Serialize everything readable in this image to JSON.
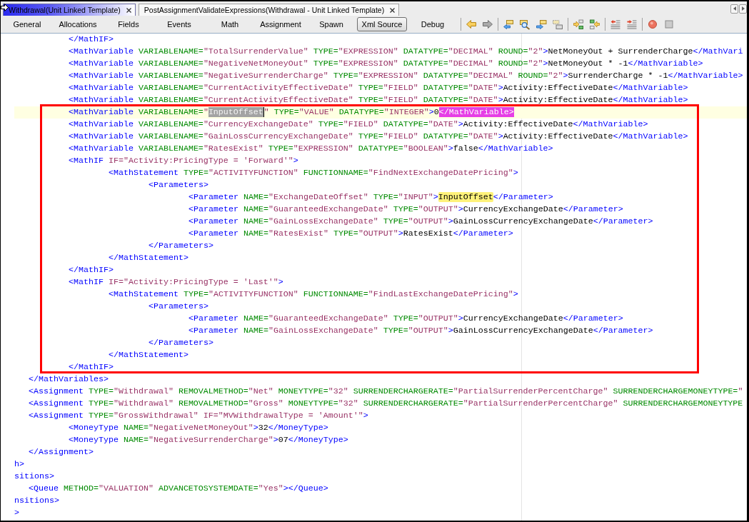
{
  "document_tabs": [
    {
      "label": "Withdrawal(Unit Linked Template)",
      "selected": true
    },
    {
      "label": "PostAssignmentValidateExpressions(Withdrawal - Unit Linked Template)",
      "selected": false
    }
  ],
  "view_tabs": [
    {
      "label": "General",
      "selected": false
    },
    {
      "label": "Allocations",
      "selected": false
    },
    {
      "label": "Fields",
      "selected": false
    },
    {
      "label": "Events",
      "selected": false
    },
    {
      "label": "Math",
      "selected": false
    },
    {
      "label": "Assignment",
      "selected": false
    },
    {
      "label": "Spawn",
      "selected": false
    },
    {
      "label": "Xml Source",
      "selected": true
    },
    {
      "label": "Debug",
      "selected": false
    }
  ],
  "toolbar": {
    "groups": [
      [
        {
          "kind": "back",
          "disabled": false
        },
        {
          "kind": "forward",
          "disabled": true
        }
      ],
      [
        {
          "kind": "cardprev",
          "disabled": false
        },
        {
          "kind": "cardsearch",
          "disabled": false
        },
        {
          "kind": "cardnext",
          "disabled": false
        },
        {
          "kind": "cardstack",
          "disabled": false
        }
      ],
      [
        {
          "kind": "arrowin",
          "disabled": false
        },
        {
          "kind": "arrowout",
          "disabled": false
        }
      ],
      [
        {
          "kind": "outdent",
          "disabled": false
        },
        {
          "kind": "indent",
          "disabled": false
        }
      ],
      [
        {
          "kind": "record",
          "disabled": false
        },
        {
          "kind": "stop",
          "disabled": false
        }
      ]
    ]
  },
  "editor": {
    "lines": [
      {
        "children": [
          {
            "children": [
              {
                "current": false,
                "segments": [
                  {
                    "kind": "tag",
                    "text": "</MathIF>"
                  }
                ]
              },
              {
                "current": false,
                "segments": [
                  {
                    "kind": "tag",
                    "text": "<MathVariable"
                  },
                  {
                    "kind": "attr",
                    "text": " VARIABLENAME="
                  },
                  {
                    "kind": "value",
                    "text": "\"TotalSurrenderValue\""
                  },
                  {
                    "kind": "attr",
                    "text": " TYPE="
                  },
                  {
                    "kind": "value",
                    "text": "\"EXPRESSION\""
                  },
                  {
                    "kind": "attr",
                    "text": " DATATYPE="
                  },
                  {
                    "kind": "value",
                    "text": "\"DECIMAL\""
                  },
                  {
                    "kind": "attr",
                    "text": " ROUND="
                  },
                  {
                    "kind": "value",
                    "text": "\"2\""
                  },
                  {
                    "kind": "tag",
                    "text": ">"
                  },
                  {
                    "kind": "text",
                    "text": "NetMoneyOut + SurrenderCharge"
                  },
                  {
                    "kind": "tag",
                    "text": "</MathVari"
                  }
                ]
              },
              {
                "current": false,
                "segments": [
                  {
                    "kind": "tag",
                    "text": "<MathVariable"
                  },
                  {
                    "kind": "attr",
                    "text": " VARIABLENAME="
                  },
                  {
                    "kind": "value",
                    "text": "\"NegativeNetMoneyOut\""
                  },
                  {
                    "kind": "attr",
                    "text": " TYPE="
                  },
                  {
                    "kind": "value",
                    "text": "\"EXPRESSION\""
                  },
                  {
                    "kind": "attr",
                    "text": " DATATYPE="
                  },
                  {
                    "kind": "value",
                    "text": "\"DECIMAL\""
                  },
                  {
                    "kind": "attr",
                    "text": " ROUND="
                  },
                  {
                    "kind": "value",
                    "text": "\"2\""
                  },
                  {
                    "kind": "tag",
                    "text": ">"
                  },
                  {
                    "kind": "text",
                    "text": "NetMoneyOut * -1"
                  },
                  {
                    "kind": "tag",
                    "text": "</MathVariable>"
                  }
                ]
              },
              {
                "current": false,
                "segments": [
                  {
                    "kind": "tag",
                    "text": "<MathVariable"
                  },
                  {
                    "kind": "attr",
                    "text": " VARIABLENAME="
                  },
                  {
                    "kind": "value",
                    "text": "\"NegativeSurrenderCharge\""
                  },
                  {
                    "kind": "attr",
                    "text": " TYPE="
                  },
                  {
                    "kind": "value",
                    "text": "\"EXPRESSION\""
                  },
                  {
                    "kind": "attr",
                    "text": " DATATYPE="
                  },
                  {
                    "kind": "value",
                    "text": "\"DECIMAL\""
                  },
                  {
                    "kind": "attr",
                    "text": " ROUND="
                  },
                  {
                    "kind": "value",
                    "text": "\"2\""
                  },
                  {
                    "kind": "tag",
                    "text": ">"
                  },
                  {
                    "kind": "text",
                    "text": "SurrenderCharge * -1"
                  },
                  {
                    "kind": "tag",
                    "text": "</MathVariable>"
                  }
                ]
              },
              {
                "current": false,
                "segments": [
                  {
                    "kind": "tag",
                    "text": "<MathVariable"
                  },
                  {
                    "kind": "attr",
                    "text": " VARIABLENAME="
                  },
                  {
                    "kind": "value",
                    "text": "\"CurrentActivityEffectiveDate\""
                  },
                  {
                    "kind": "attr",
                    "text": " TYPE="
                  },
                  {
                    "kind": "value",
                    "text": "\"FIELD\""
                  },
                  {
                    "kind": "attr",
                    "text": " DATATYPE="
                  },
                  {
                    "kind": "value",
                    "text": "\"DATE\""
                  },
                  {
                    "kind": "tag",
                    "text": ">"
                  },
                  {
                    "kind": "text",
                    "text": "Activity:EffectiveDate"
                  },
                  {
                    "kind": "tag",
                    "text": "</MathVariable>"
                  }
                ]
              },
              {
                "current": false,
                "segments": [
                  {
                    "kind": "tag",
                    "text": "<MathVariable"
                  },
                  {
                    "kind": "attr",
                    "text": " VARIABLENAME="
                  },
                  {
                    "kind": "value",
                    "text": "\"CurrentActivityEffectiveDate\""
                  },
                  {
                    "kind": "attr",
                    "text": " TYPE="
                  },
                  {
                    "kind": "value",
                    "text": "\"FIELD\""
                  },
                  {
                    "kind": "attr",
                    "text": " DATATYPE="
                  },
                  {
                    "kind": "value",
                    "text": "\"DATE\""
                  },
                  {
                    "kind": "tag",
                    "text": ">"
                  },
                  {
                    "kind": "text",
                    "text": "Activity:EffectiveDate"
                  },
                  {
                    "kind": "tag",
                    "text": "</MathVariable>"
                  }
                ]
              },
              {
                "current": true,
                "segments": [
                  {
                    "kind": "tag",
                    "text": "<MathVariable"
                  },
                  {
                    "kind": "attr",
                    "text": " VARIABLENAME="
                  },
                  {
                    "kind": "value",
                    "text": "\""
                  },
                  {
                    "kind": "value",
                    "text": "InputOffset",
                    "selected": true,
                    "cursor": true
                  },
                  {
                    "kind": "value",
                    "text": "\""
                  },
                  {
                    "kind": "attr",
                    "text": " TYPE="
                  },
                  {
                    "kind": "value",
                    "text": "\"VALUE\""
                  },
                  {
                    "kind": "attr",
                    "text": " DATATYPE="
                  },
                  {
                    "kind": "value",
                    "text": "\"INTEGER\""
                  },
                  {
                    "kind": "tag",
                    "text": ">"
                  },
                  {
                    "kind": "text",
                    "text": "0"
                  },
                  {
                    "kind": "tag",
                    "text": "</MathVariable>",
                    "matched": true
                  }
                ]
              },
              {
                "current": false,
                "segments": [
                  {
                    "kind": "tag",
                    "text": "<MathVariable"
                  },
                  {
                    "kind": "attr",
                    "text": " VARIABLENAME="
                  },
                  {
                    "kind": "value",
                    "text": "\"CurrencyExchangeDate\""
                  },
                  {
                    "kind": "attr",
                    "text": " TYPE="
                  },
                  {
                    "kind": "value",
                    "text": "\"FIELD\""
                  },
                  {
                    "kind": "attr",
                    "text": " DATATYPE="
                  },
                  {
                    "kind": "value",
                    "text": "\"DATE\""
                  },
                  {
                    "kind": "tag",
                    "text": ">"
                  },
                  {
                    "kind": "text",
                    "text": "Activity:EffectiveDate"
                  },
                  {
                    "kind": "tag",
                    "text": "</MathVariable>"
                  }
                ]
              },
              {
                "current": false,
                "segments": [
                  {
                    "kind": "tag",
                    "text": "<MathVariable"
                  },
                  {
                    "kind": "attr",
                    "text": " VARIABLENAME="
                  },
                  {
                    "kind": "value",
                    "text": "\"GainLossCurrencyExchangeDate\""
                  },
                  {
                    "kind": "attr",
                    "text": " TYPE="
                  },
                  {
                    "kind": "value",
                    "text": "\"FIELD\""
                  },
                  {
                    "kind": "attr",
                    "text": " DATATYPE="
                  },
                  {
                    "kind": "value",
                    "text": "\"DATE\""
                  },
                  {
                    "kind": "tag",
                    "text": ">"
                  },
                  {
                    "kind": "text",
                    "text": "Activity:EffectiveDate"
                  },
                  {
                    "kind": "tag",
                    "text": "</MathVariable>"
                  }
                ]
              },
              {
                "current": false,
                "segments": [
                  {
                    "kind": "tag",
                    "text": "<MathVariable"
                  },
                  {
                    "kind": "attr",
                    "text": " VARIABLENAME="
                  },
                  {
                    "kind": "value",
                    "text": "\"RatesExist\""
                  },
                  {
                    "kind": "attr",
                    "text": " TYPE="
                  },
                  {
                    "kind": "value",
                    "text": "\"EXPRESSION\""
                  },
                  {
                    "kind": "attr",
                    "text": " DATATYPE="
                  },
                  {
                    "kind": "value",
                    "text": "\"BOOLEAN\""
                  },
                  {
                    "kind": "tag",
                    "text": ">"
                  },
                  {
                    "kind": "text",
                    "text": "false"
                  },
                  {
                    "kind": "tag",
                    "text": "</MathVariable>"
                  }
                ]
              },
              {
                "current": false,
                "segments": [
                  {
                    "kind": "tag",
                    "text": "<MathIF"
                  },
                  {
                    "kind": "value",
                    "text": " IF=\"Activity:PricingType = 'Forward'\""
                  },
                  {
                    "kind": "tag",
                    "text": ">"
                  }
                ],
                "children": [
                  {
                    "current": false,
                    "segments": [
                      {
                        "kind": "tag",
                        "text": "<MathStatement"
                      },
                      {
                        "kind": "attr",
                        "text": " TYPE="
                      },
                      {
                        "kind": "value",
                        "text": "\"ACTIVITYFUNCTION\""
                      },
                      {
                        "kind": "attr",
                        "text": " FUNCTIONNAME="
                      },
                      {
                        "kind": "value",
                        "text": "\"FindNextExchangeDatePricing\""
                      },
                      {
                        "kind": "tag",
                        "text": ">"
                      }
                    ],
                    "children": [
                      {
                        "current": false,
                        "segments": [
                          {
                            "kind": "tag",
                            "text": "<Parameters>"
                          }
                        ],
                        "children": [
                          {
                            "current": false,
                            "segments": [
                              {
                                "kind": "tag",
                                "text": "<Parameter"
                              },
                              {
                                "kind": "attr",
                                "text": " NAME="
                              },
                              {
                                "kind": "value",
                                "text": "\"ExchangeDateOffset\""
                              },
                              {
                                "kind": "attr",
                                "text": " TYPE="
                              },
                              {
                                "kind": "value",
                                "text": "\"INPUT\""
                              },
                              {
                                "kind": "tag",
                                "text": ">"
                              },
                              {
                                "kind": "text",
                                "text": "InputOffset",
                                "marked": true
                              },
                              {
                                "kind": "tag",
                                "text": "</Parameter>"
                              }
                            ]
                          },
                          {
                            "current": false,
                            "segments": [
                              {
                                "kind": "tag",
                                "text": "<Parameter"
                              },
                              {
                                "kind": "attr",
                                "text": " NAME="
                              },
                              {
                                "kind": "value",
                                "text": "\"GuaranteedExchangeDate\""
                              },
                              {
                                "kind": "attr",
                                "text": " TYPE="
                              },
                              {
                                "kind": "value",
                                "text": "\"OUTPUT\""
                              },
                              {
                                "kind": "tag",
                                "text": ">"
                              },
                              {
                                "kind": "text",
                                "text": "CurrencyExchangeDate"
                              },
                              {
                                "kind": "tag",
                                "text": "</Parameter>"
                              }
                            ]
                          },
                          {
                            "current": false,
                            "segments": [
                              {
                                "kind": "tag",
                                "text": "<Parameter"
                              },
                              {
                                "kind": "attr",
                                "text": " NAME="
                              },
                              {
                                "kind": "value",
                                "text": "\"GainLossExchangeDate\""
                              },
                              {
                                "kind": "attr",
                                "text": " TYPE="
                              },
                              {
                                "kind": "value",
                                "text": "\"OUTPUT\""
                              },
                              {
                                "kind": "tag",
                                "text": ">"
                              },
                              {
                                "kind": "text",
                                "text": "GainLossCurrencyExchangeDate"
                              },
                              {
                                "kind": "tag",
                                "text": "</Parameter>"
                              }
                            ]
                          },
                          {
                            "current": false,
                            "segments": [
                              {
                                "kind": "tag",
                                "text": "<Parameter"
                              },
                              {
                                "kind": "attr",
                                "text": " NAME="
                              },
                              {
                                "kind": "value",
                                "text": "\"RatesExist\""
                              },
                              {
                                "kind": "attr",
                                "text": " TYPE="
                              },
                              {
                                "kind": "value",
                                "text": "\"OUTPUT\""
                              },
                              {
                                "kind": "tag",
                                "text": ">"
                              },
                              {
                                "kind": "text",
                                "text": "RatesExist"
                              },
                              {
                                "kind": "tag",
                                "text": "</Parameter>"
                              }
                            ]
                          }
                        ]
                      },
                      {
                        "current": false,
                        "segments": [
                          {
                            "kind": "tag",
                            "text": "</Parameters>"
                          }
                        ]
                      }
                    ]
                  },
                  {
                    "current": false,
                    "segments": [
                      {
                        "kind": "tag",
                        "text": "</MathStatement>"
                      }
                    ]
                  }
                ]
              },
              {
                "current": false,
                "segments": [
                  {
                    "kind": "tag",
                    "text": "</MathIF>"
                  }
                ]
              },
              {
                "current": false,
                "segments": [
                  {
                    "kind": "tag",
                    "text": "<MathIF"
                  },
                  {
                    "kind": "value",
                    "text": " IF=\"Activity:PricingType = 'Last'\""
                  },
                  {
                    "kind": "tag",
                    "text": ">"
                  }
                ],
                "children": [
                  {
                    "current": false,
                    "segments": [
                      {
                        "kind": "tag",
                        "text": "<MathStatement"
                      },
                      {
                        "kind": "attr",
                        "text": " TYPE="
                      },
                      {
                        "kind": "value",
                        "text": "\"ACTIVITYFUNCTION\""
                      },
                      {
                        "kind": "attr",
                        "text": " FUNCTIONNAME="
                      },
                      {
                        "kind": "value",
                        "text": "\"FindLastExchangeDatePricing\""
                      },
                      {
                        "kind": "tag",
                        "text": ">"
                      }
                    ],
                    "children": [
                      {
                        "current": false,
                        "segments": [
                          {
                            "kind": "tag",
                            "text": "<Parameters>"
                          }
                        ],
                        "children": [
                          {
                            "current": false,
                            "segments": [
                              {
                                "kind": "tag",
                                "text": "<Parameter"
                              },
                              {
                                "kind": "attr",
                                "text": " NAME="
                              },
                              {
                                "kind": "value",
                                "text": "\"GuaranteedExchangeDate\""
                              },
                              {
                                "kind": "attr",
                                "text": " TYPE="
                              },
                              {
                                "kind": "value",
                                "text": "\"OUTPUT\""
                              },
                              {
                                "kind": "tag",
                                "text": ">"
                              },
                              {
                                "kind": "text",
                                "text": "CurrencyExchangeDate"
                              },
                              {
                                "kind": "tag",
                                "text": "</Parameter>"
                              }
                            ]
                          },
                          {
                            "current": false,
                            "segments": [
                              {
                                "kind": "tag",
                                "text": "<Parameter"
                              },
                              {
                                "kind": "attr",
                                "text": " NAME="
                              },
                              {
                                "kind": "value",
                                "text": "\"GainLossExchangeDate\""
                              },
                              {
                                "kind": "attr",
                                "text": " TYPE="
                              },
                              {
                                "kind": "value",
                                "text": "\"OUTPUT\""
                              },
                              {
                                "kind": "tag",
                                "text": ">"
                              },
                              {
                                "kind": "text",
                                "text": "GainLossCurrencyExchangeDate"
                              },
                              {
                                "kind": "tag",
                                "text": "</Parameter>"
                              }
                            ]
                          }
                        ]
                      },
                      {
                        "current": false,
                        "segments": [
                          {
                            "kind": "tag",
                            "text": "</Parameters>"
                          }
                        ]
                      }
                    ]
                  },
                  {
                    "current": false,
                    "segments": [
                      {
                        "kind": "tag",
                        "text": "</MathStatement>"
                      }
                    ]
                  }
                ]
              },
              {
                "current": false,
                "segments": [
                  {
                    "kind": "tag",
                    "text": "</MathIF>"
                  }
                ]
              }
            ]
          },
          {
            "current": false,
            "segments": [
              {
                "kind": "tag",
                "text": "</MathVariables>"
              }
            ]
          },
          {
            "current": false,
            "segments": [
              {
                "kind": "tag",
                "text": "<Assignment"
              },
              {
                "kind": "attr",
                "text": " TYPE="
              },
              {
                "kind": "value",
                "text": "\"Withdrawal\""
              },
              {
                "kind": "attr",
                "text": " REMOVALMETHOD="
              },
              {
                "kind": "value",
                "text": "\"Net\""
              },
              {
                "kind": "attr",
                "text": " MONEYTYPE="
              },
              {
                "kind": "value",
                "text": "\"32\""
              },
              {
                "kind": "attr",
                "text": " SURRENDERCHARGERATE="
              },
              {
                "kind": "value",
                "text": "\"PartialSurrenderPercentCharge\""
              },
              {
                "kind": "attr",
                "text": " SURRENDERCHARGEMONEYTYPE="
              },
              {
                "kind": "value",
                "text": "\""
              }
            ]
          },
          {
            "current": false,
            "segments": [
              {
                "kind": "tag",
                "text": "<Assignment"
              },
              {
                "kind": "attr",
                "text": " TYPE="
              },
              {
                "kind": "value",
                "text": "\"Withdrawal\""
              },
              {
                "kind": "attr",
                "text": " REMOVALMETHOD="
              },
              {
                "kind": "value",
                "text": "\"Gross\""
              },
              {
                "kind": "attr",
                "text": " MONEYTYPE="
              },
              {
                "kind": "value",
                "text": "\"32\""
              },
              {
                "kind": "attr",
                "text": " SURRENDERCHARGERATE="
              },
              {
                "kind": "value",
                "text": "\"PartialSurrenderPercentCharge\""
              },
              {
                "kind": "attr",
                "text": " SURRENDERCHARGEMONEYTYPE"
              }
            ]
          },
          {
            "current": false,
            "segments": [
              {
                "kind": "tag",
                "text": "<Assignment"
              },
              {
                "kind": "attr",
                "text": " TYPE="
              },
              {
                "kind": "value",
                "text": "\"GrossWithdrawal\""
              },
              {
                "kind": "value",
                "text": " IF=\"MVWithdrawalType = 'Amount'\""
              },
              {
                "kind": "tag",
                "text": ">"
              }
            ],
            "children": [
              {
                "current": false,
                "segments": [
                  {
                    "kind": "tag",
                    "text": "<MoneyType"
                  },
                  {
                    "kind": "attr",
                    "text": " NAME="
                  },
                  {
                    "kind": "value",
                    "text": "\"NegativeNetMoneyOut\""
                  },
                  {
                    "kind": "tag",
                    "text": ">"
                  },
                  {
                    "kind": "text",
                    "text": "32"
                  },
                  {
                    "kind": "tag",
                    "text": "</MoneyType>"
                  }
                ]
              },
              {
                "current": false,
                "segments": [
                  {
                    "kind": "tag",
                    "text": "<MoneyType"
                  },
                  {
                    "kind": "attr",
                    "text": " NAME="
                  },
                  {
                    "kind": "value",
                    "text": "\"NegativeSurrenderCharge\""
                  },
                  {
                    "kind": "tag",
                    "text": ">"
                  },
                  {
                    "kind": "text",
                    "text": "07"
                  },
                  {
                    "kind": "tag",
                    "text": "</MoneyType>"
                  }
                ]
              }
            ]
          },
          {
            "current": false,
            "segments": [
              {
                "kind": "tag",
                "text": "</Assignment>"
              }
            ]
          }
        ]
      },
      {
        "current": false,
        "segments": [
          {
            "kind": "tag",
            "text": "h>"
          }
        ]
      },
      {
        "current": false,
        "segments": [
          {
            "kind": "tag",
            "text": "sitions>"
          }
        ],
        "children": [
          {
            "current": false,
            "segments": [
              {
                "kind": "tag",
                "text": "<Queue"
              },
              {
                "kind": "attr",
                "text": " METHOD="
              },
              {
                "kind": "value",
                "text": "\"VALUATION\""
              },
              {
                "kind": "attr",
                "text": " ADVANCETOSYSTEMDATE="
              },
              {
                "kind": "value",
                "text": "\"Yes\""
              },
              {
                "kind": "tag",
                "text": "></Queue>"
              }
            ]
          }
        ]
      },
      {
        "current": false,
        "segments": [
          {
            "kind": "tag",
            "text": "nsitions>"
          }
        ]
      },
      {
        "current": false,
        "segments": [
          {
            "kind": "tag",
            "text": ">"
          }
        ]
      }
    ]
  }
}
